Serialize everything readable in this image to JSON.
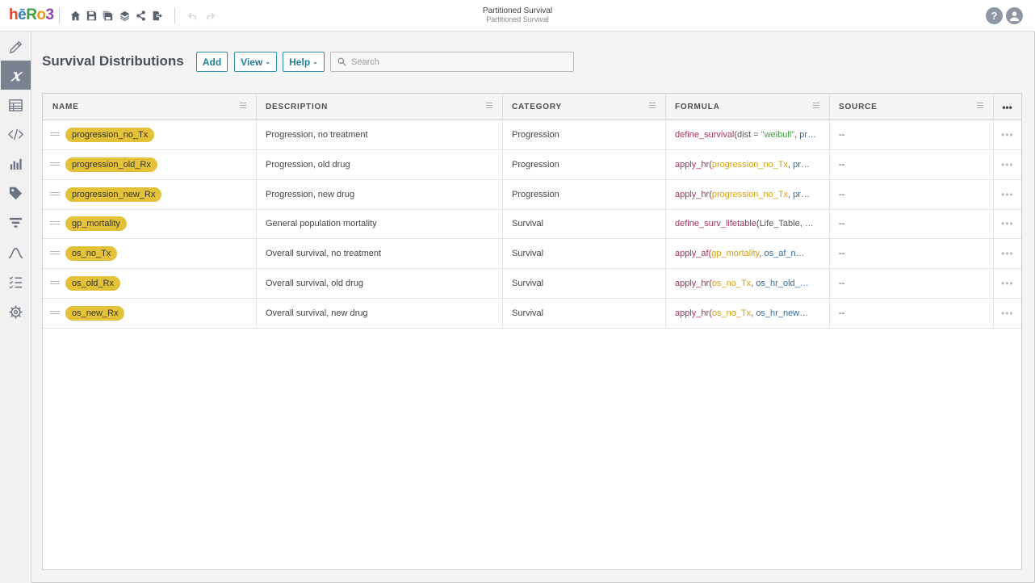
{
  "app": {
    "logo": {
      "h": "h",
      "e": "ē",
      "R": "R",
      "o": "o",
      "n": "3"
    },
    "title": "Partitioned Survival",
    "subtitle": "Partitioned Survival",
    "help_glyph": "?",
    "toolbar_icons": [
      "home-icon",
      "save-icon",
      "save-as-icon",
      "layers-icon",
      "share-icon",
      "export-icon",
      "undo-icon",
      "redo-icon"
    ]
  },
  "sidebar": {
    "items": [
      "pencil-icon",
      "variable-x-icon",
      "table-icon",
      "code-icon",
      "bar-chart-icon",
      "tag-icon",
      "filter-icon",
      "curve-icon",
      "checklist-icon",
      "gear-icon"
    ],
    "active_index": 1,
    "active_glyph": "𝑥"
  },
  "page": {
    "title": "Survival Distributions",
    "buttons": {
      "add": "Add",
      "view": "View",
      "help": "Help"
    },
    "search_placeholder": "Search"
  },
  "table": {
    "headers": [
      "NAME",
      "DESCRIPTION",
      "CATEGORY",
      "FORMULA",
      "SOURCE"
    ],
    "more_glyph": "•••",
    "row_more_glyph": "•••",
    "rows": [
      {
        "name": "progression_no_Tx",
        "description": "Progression, no treatment",
        "category": "Progression",
        "formula": [
          {
            "t": "define_survival",
            "c": "fn"
          },
          {
            "t": "(dist = ",
            "c": "txt"
          },
          {
            "t": "\"weibull\"",
            "c": "str"
          },
          {
            "t": ", ",
            "c": "txt"
          },
          {
            "t": "pr…",
            "c": "ref"
          }
        ],
        "source": "--"
      },
      {
        "name": "progression_old_Rx",
        "description": "Progression, old drug",
        "category": "Progression",
        "formula": [
          {
            "t": "apply_hr",
            "c": "fn"
          },
          {
            "t": "(",
            "c": "fn"
          },
          {
            "t": "progression_no_Tx",
            "c": "var"
          },
          {
            "t": ", ",
            "c": "txt"
          },
          {
            "t": "pr…",
            "c": "ref"
          }
        ],
        "source": "--"
      },
      {
        "name": "progression_new_Rx",
        "description": "Progression, new drug",
        "category": "Progression",
        "formula": [
          {
            "t": "apply_hr",
            "c": "fn"
          },
          {
            "t": "(",
            "c": "fn"
          },
          {
            "t": "progression_no_Tx",
            "c": "var"
          },
          {
            "t": ", ",
            "c": "txt"
          },
          {
            "t": "pr…",
            "c": "ref"
          }
        ],
        "source": "--"
      },
      {
        "name": "gp_mortality",
        "description": "General population mortality",
        "category": "Survival",
        "formula": [
          {
            "t": "define_surv_lifetable",
            "c": "fn"
          },
          {
            "t": "(Life_Table, …",
            "c": "txt"
          }
        ],
        "source": "--"
      },
      {
        "name": "os_no_Tx",
        "description": "Overall survival, no treatment",
        "category": "Survival",
        "formula": [
          {
            "t": "apply_af",
            "c": "fn"
          },
          {
            "t": "(",
            "c": "fn"
          },
          {
            "t": "gp_mortality",
            "c": "var"
          },
          {
            "t": ", ",
            "c": "txt"
          },
          {
            "t": "os_af_n…",
            "c": "ref"
          }
        ],
        "source": "--"
      },
      {
        "name": "os_old_Rx",
        "description": "Overall survival, old drug",
        "category": "Survival",
        "formula": [
          {
            "t": "apply_hr",
            "c": "fn"
          },
          {
            "t": "(",
            "c": "fn"
          },
          {
            "t": "os_no_Tx",
            "c": "var"
          },
          {
            "t": ", ",
            "c": "txt"
          },
          {
            "t": "os_hr_old_…",
            "c": "ref"
          }
        ],
        "source": "--"
      },
      {
        "name": "os_new_Rx",
        "description": "Overall survival, new drug",
        "category": "Survival",
        "formula": [
          {
            "t": "apply_hr",
            "c": "fn"
          },
          {
            "t": "(",
            "c": "fn"
          },
          {
            "t": "os_no_Tx",
            "c": "var"
          },
          {
            "t": ", ",
            "c": "txt"
          },
          {
            "t": "os_hr_new…",
            "c": "ref"
          }
        ],
        "source": "--"
      }
    ]
  },
  "colors": {
    "accent": "#2f8fa6",
    "pill": "#e3c23a",
    "sidebar_active": "#7a8190"
  }
}
